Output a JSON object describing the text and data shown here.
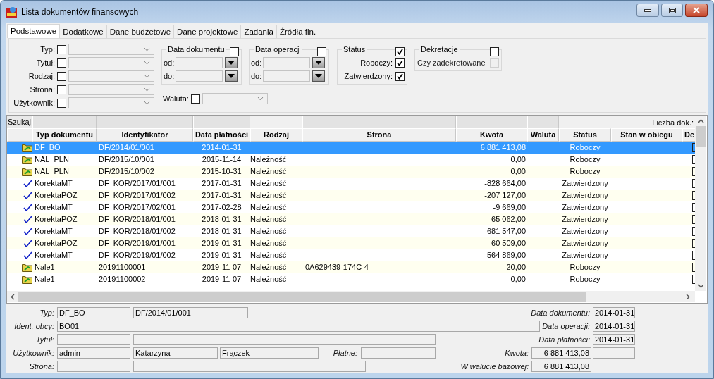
{
  "window": {
    "title": "Lista dokumentów finansowych"
  },
  "tabs": [
    {
      "label": "Podstawowe",
      "selected": true
    },
    {
      "label": "Dodatkowe",
      "selected": false
    },
    {
      "label": "Dane budżetowe",
      "selected": false
    },
    {
      "label": "Dane projektowe",
      "selected": false
    },
    {
      "label": "Zadania",
      "selected": false
    },
    {
      "label": "Źródła fin.",
      "selected": false
    }
  ],
  "filters": {
    "fields": [
      {
        "label": "Typ:",
        "checked": false
      },
      {
        "label": "Tytuł:",
        "checked": false
      },
      {
        "label": "Rodzaj:",
        "checked": false
      },
      {
        "label": "Strona:",
        "checked": false
      },
      {
        "label": "Użytkownik:",
        "checked": false
      }
    ],
    "data_dokumentu": {
      "title": "Data dokumentu",
      "checked": false,
      "from_label": "od:",
      "to_label": "do:"
    },
    "data_operacji": {
      "title": "Data operacji",
      "checked": false,
      "from_label": "od:",
      "to_label": "do:"
    },
    "status": {
      "title": "Status",
      "checked": true,
      "options": [
        {
          "label": "Roboczy:",
          "checked": true
        },
        {
          "label": "Zatwierdzony:",
          "checked": true
        }
      ]
    },
    "dekretacje": {
      "title": "Dekretacje",
      "checked": false,
      "option": {
        "label": "Czy zadekretowane",
        "checked": false,
        "disabled": true
      }
    },
    "waluta": {
      "label": "Waluta:",
      "checked": false
    }
  },
  "grid": {
    "search_label": "Szukaj:",
    "count_label": "Liczba dok.:",
    "columns": [
      "Typ dokumentu",
      "Identyfikator",
      "Data płatności",
      "Rodzaj",
      "Strona",
      "Kwota",
      "Waluta",
      "Status",
      "Stan w obiegu",
      "De"
    ],
    "rows": [
      {
        "kind": "folder",
        "selected": true,
        "typ": "DF_BO",
        "identyfikator": "DF/2014/01/001",
        "data_platnosci": "2014-01-31",
        "kwota": "6 881 413,08",
        "status": "Roboczy"
      },
      {
        "kind": "folder",
        "selected": false,
        "typ": "NAL_PLN",
        "identyfikator": "DF/2015/10/001",
        "data_platnosci": "2015-11-14",
        "rodzaj": "Należność",
        "kwota": "0,00",
        "status": "Roboczy"
      },
      {
        "kind": "folder",
        "selected": false,
        "typ": "NAL_PLN",
        "identyfikator": "DF/2015/10/002",
        "data_platnosci": "2015-10-31",
        "rodzaj": "Należność",
        "kwota": "0,00",
        "status": "Roboczy"
      },
      {
        "kind": "check",
        "selected": false,
        "typ": "KorektaMT",
        "identyfikator": "DF_KOR/2017/01/001",
        "data_platnosci": "2017-01-31",
        "rodzaj": "Należność",
        "kwota": "-828 664,00",
        "status": "Zatwierdzony"
      },
      {
        "kind": "check",
        "selected": false,
        "typ": "KorektaPOZ",
        "identyfikator": "DF_KOR/2017/01/002",
        "data_platnosci": "2017-01-31",
        "rodzaj": "Należność",
        "kwota": "-207 127,00",
        "status": "Zatwierdzony"
      },
      {
        "kind": "check",
        "selected": false,
        "typ": "KorektaMT",
        "identyfikator": "DF_KOR/2017/02/001",
        "data_platnosci": "2017-02-28",
        "rodzaj": "Należność",
        "kwota": "-9 669,00",
        "status": "Zatwierdzony"
      },
      {
        "kind": "check",
        "selected": false,
        "typ": "KorektaPOZ",
        "identyfikator": "DF_KOR/2018/01/001",
        "data_platnosci": "2018-01-31",
        "rodzaj": "Należność",
        "kwota": "-65 062,00",
        "status": "Zatwierdzony"
      },
      {
        "kind": "check",
        "selected": false,
        "typ": "KorektaMT",
        "identyfikator": "DF_KOR/2018/01/002",
        "data_platnosci": "2018-01-31",
        "rodzaj": "Należność",
        "kwota": "-681 547,00",
        "status": "Zatwierdzony"
      },
      {
        "kind": "check",
        "selected": false,
        "typ": "KorektaPOZ",
        "identyfikator": "DF_KOR/2019/01/001",
        "data_platnosci": "2019-01-31",
        "rodzaj": "Należność",
        "kwota": "60 509,00",
        "status": "Zatwierdzony"
      },
      {
        "kind": "check",
        "selected": false,
        "typ": "KorektaMT",
        "identyfikator": "DF_KOR/2019/01/002",
        "data_platnosci": "2019-01-31",
        "rodzaj": "Należność",
        "kwota": "-564 869,00",
        "status": "Zatwierdzony"
      },
      {
        "kind": "folder",
        "selected": false,
        "typ": "Nale1",
        "identyfikator": "20191100001",
        "data_platnosci": "2019-11-07",
        "rodzaj": "Należność",
        "strona": "0A629439-174C-4",
        "kwota": "20,00",
        "status": "Roboczy"
      },
      {
        "kind": "folder",
        "selected": false,
        "typ": "Nale1",
        "identyfikator": "20191100002",
        "data_platnosci": "2019-11-07",
        "rodzaj": "Należność",
        "kwota": "0,00",
        "status": "Roboczy"
      }
    ]
  },
  "details": {
    "lines": [
      {
        "groups": [
          {
            "label": "Typ:",
            "values": [
              {
                "kind": "field",
                "text": "DF_BO"
              },
              {
                "kind": "field",
                "text": "DF/2014/01/001"
              }
            ]
          },
          {
            "label": "Data dokumentu:",
            "values": [
              {
                "kind": "field",
                "text": "2014-01-31"
              }
            ]
          }
        ]
      },
      {
        "groups": [
          {
            "label": "Ident. obcy:",
            "values": [
              {
                "kind": "field",
                "text": "BO01"
              }
            ]
          },
          {
            "label": "Data operacji:",
            "values": [
              {
                "kind": "field",
                "text": "2014-01-31"
              }
            ]
          }
        ]
      },
      {
        "groups": [
          {
            "label": "Tytuł:",
            "values": [
              {
                "kind": "field"
              },
              {
                "kind": "field"
              }
            ]
          },
          {
            "label": "Data płatności:",
            "values": [
              {
                "kind": "field",
                "text": "2014-01-31"
              }
            ]
          }
        ]
      },
      {
        "groups": [
          {
            "label": "Użytkownik:",
            "values": [
              {
                "kind": "field",
                "text": "admin"
              },
              {
                "kind": "field",
                "text": "Katarzyna"
              },
              {
                "kind": "field",
                "text": "Frączek"
              }
            ]
          },
          {
            "label": "Płatne:",
            "values": [
              {
                "kind": "field"
              }
            ]
          },
          {
            "label": "Kwota:",
            "values": [
              {
                "kind": "amount",
                "text": "6 881 413,08"
              },
              {
                "kind": "field"
              }
            ]
          }
        ]
      },
      {
        "groups": [
          {
            "label": "Strona:",
            "values": [
              {
                "kind": "field"
              },
              {
                "kind": "field"
              }
            ]
          },
          {
            "label": "W walucie bazowej:",
            "values": [
              {
                "kind": "amount",
                "text": "6 881 413,08"
              }
            ]
          }
        ]
      }
    ]
  }
}
